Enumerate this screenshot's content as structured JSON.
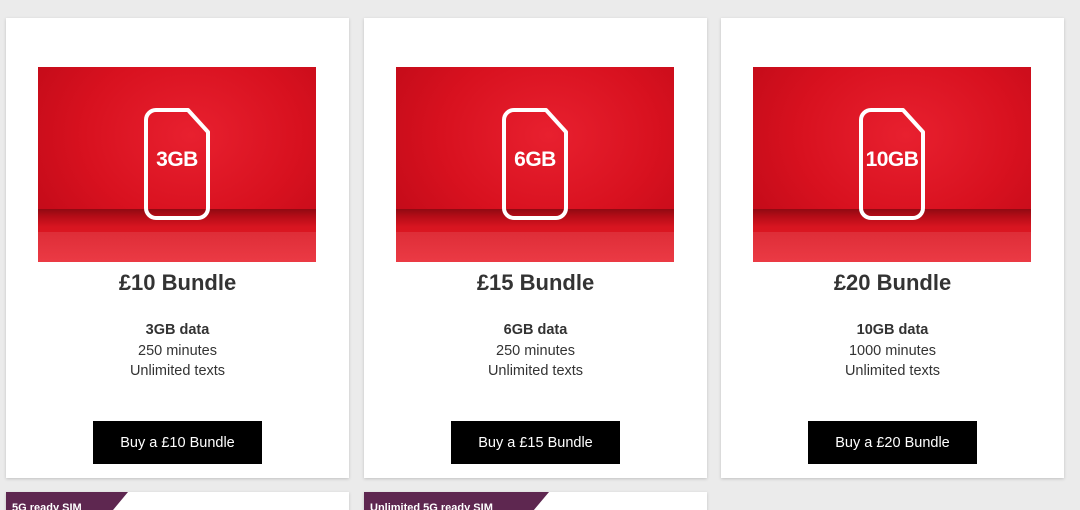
{
  "bundles": [
    {
      "title": "£10 Bundle",
      "sim_label": "3GB",
      "data": "3GB data",
      "minutes": "250 minutes",
      "texts": "Unlimited texts",
      "button_label": "Buy a £10 Bundle"
    },
    {
      "title": "£15 Bundle",
      "sim_label": "6GB",
      "data": "6GB data",
      "minutes": "250 minutes",
      "texts": "Unlimited texts",
      "button_label": "Buy a £15 Bundle"
    },
    {
      "title": "£20 Bundle",
      "sim_label": "10GB",
      "data": "10GB data",
      "minutes": "1000 minutes",
      "texts": "Unlimited texts",
      "button_label": "Buy a £20 Bundle"
    }
  ],
  "sim_cards": [
    {
      "ribbon": "5G ready SIM"
    },
    {
      "ribbon": "Unlimited 5G ready SIM"
    }
  ],
  "colors": {
    "brand_red": "#e60000",
    "button_bg": "#000000",
    "ribbon_bg": "#5e2750",
    "page_bg": "#ebebeb"
  }
}
